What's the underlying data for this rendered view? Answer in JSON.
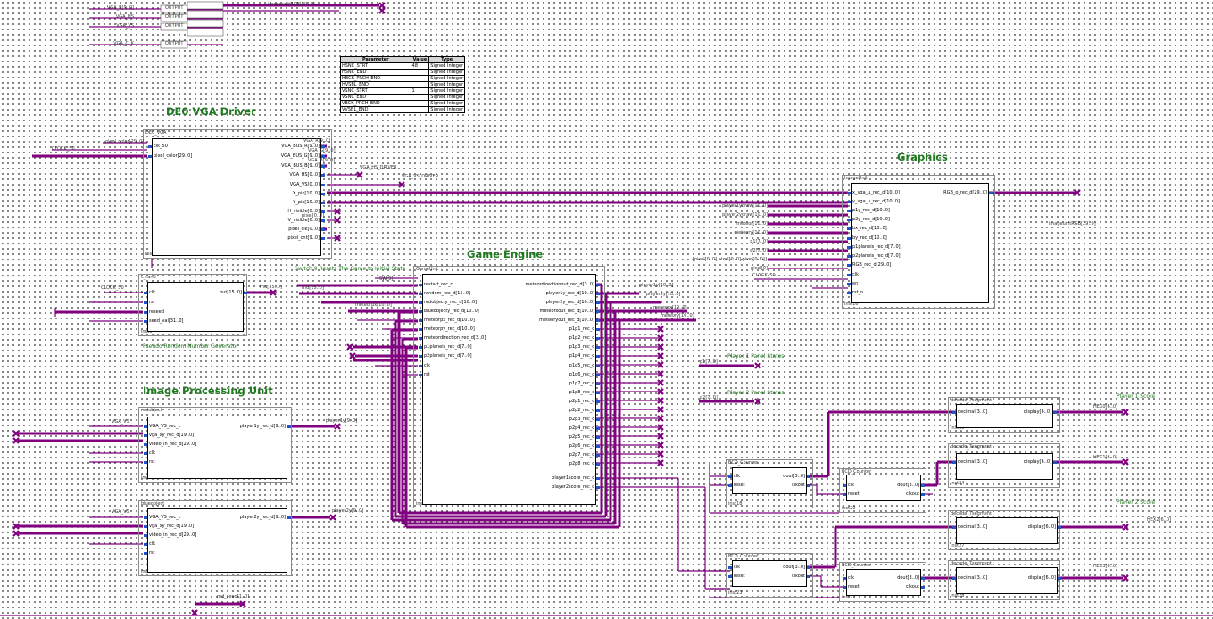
{
  "titles": {
    "vga_driver": "DE0 VGA Driver",
    "graphics": "Graphics",
    "game_engine": "Game Engine",
    "image_processing": "Image Processing Unit"
  },
  "notes": {
    "prng": "Pseudo Random Number Generator",
    "reset": "Switch 9 Resets The Game to Initial State",
    "p1_panel": "Player 1 Panel States",
    "p2_panel": "Player 2 Panel States",
    "p1_score": "Player 1 Score",
    "p2_score": "Player 2 Score"
  },
  "param_table": {
    "headers": [
      "Parameter",
      "Value",
      "Type"
    ],
    "rows": [
      [
        "HSNC_STRT",
        "48",
        "Signed Integer"
      ],
      [
        "HSNC_END",
        "",
        "Signed Integer"
      ],
      [
        "HBCK_PRCH_END",
        "",
        "Signed Integer"
      ],
      [
        "HVSBL_END",
        "",
        "Signed Integer"
      ],
      [
        "VSNC_STRT",
        "1",
        "Signed Integer"
      ],
      [
        "VSNC_END",
        "",
        "Signed Integer"
      ],
      [
        "VBCK_PRCH_END",
        "",
        "Signed Integer"
      ],
      [
        "VVSBL_END",
        "",
        "Signed Integer"
      ]
    ]
  },
  "blocks": {
    "de0_vga": {
      "type": "DE0_VGA",
      "inst": "inst11",
      "in": [
        "clk_50",
        "pixel_color[29..0]"
      ],
      "out": [
        "VGA_BUS_R[9..0]",
        "VGA_BUS_G[9..0]",
        "VGA_BUS_B[9..0]",
        "VGA_HS[0..0]",
        "VGA_VS[0..0]",
        "X_pix[10..0]",
        "Y_pix[10..0]",
        "H_visible[0..0]",
        "V_visible[0..0]",
        "pixel_clk[0..0]",
        "pixel_cnt[9..0]"
      ]
    },
    "c_rand": {
      "type": "c_rand",
      "inst": "inst6",
      "in": [
        "clk",
        "rst",
        "reseed",
        "seed_val[31..0]"
      ],
      "out": [
        "out[15..0]"
      ]
    },
    "redobject": {
      "type": "redobject",
      "inst": "inst4",
      "in": [
        "VGA_VS_rec_c",
        "vga_xy_rec_d[19..0]",
        "video_in_rec_d[29..0]",
        "clk",
        "rst"
      ],
      "out": [
        "player1y_rec_d[9..0]"
      ]
    },
    "blueobject": {
      "type": "blueobject",
      "inst": "inst1",
      "in": [
        "VGA_VS_rec_c",
        "vga_xy_rec_d[19..0]",
        "video_in_rec_d[29..0]",
        "clk",
        "rst"
      ],
      "out": [
        "player2y_rec_d[9..0]"
      ]
    },
    "gameunit": {
      "type": "GameUnit",
      "inst": "inst21",
      "in": [
        "restart_rec_c",
        "random_rec_d[15..0]",
        "redobjecty_rec_d[10..0]",
        "blueobjecty_rec_d[10..0]",
        "meteorpx_rec_d[10..0]",
        "meteorpy_rec_d[10..0]",
        "meteordirection_rec_d[3..0]",
        "p1planeis_rec_d[7..0]",
        "p2planeis_rec_d[7..0]",
        "clk",
        "rst"
      ],
      "out": [
        "meteordirectionout_rec_d[3..0]",
        "player1y_rec_d[10..0]",
        "player2y_rec_d[10..0]",
        "meteorxout_rec_d[10..0]",
        "meteoryout_rec_d[10..0]",
        "p1p1_rec_c",
        "p1p2_rec_c",
        "p1p3_rec_c",
        "p1p4_rec_c",
        "p1p5_rec_c",
        "p1p6_rec_c",
        "p1p7_rec_c",
        "p1p8_rec_c",
        "p2p1_rec_c",
        "p2p2_rec_c",
        "p2p3_rec_c",
        "p2p4_rec_c",
        "p2p5_rec_c",
        "p2p6_rec_c",
        "p2p7_rec_c",
        "p2p8_rec_c",
        "player1score_rec_c",
        "player2score_rec_c"
      ]
    },
    "imageunit": {
      "type": "ImageUnit",
      "inst": "inst16",
      "in": [
        "x_vga_u_rec_d[10..0]",
        "y_vga_u_rec_d[10..0]",
        "p1y_rec_d[10..0]",
        "p2y_rec_d[10..0]",
        "bx_rec_d[10..0]",
        "by_rec_d[10..0]",
        "p1planeis_rec_d[7..0]",
        "p2planeis_rec_d[7..0]",
        "RGB_rec_d[29..0]",
        "clk",
        "en",
        "rst_n"
      ],
      "out": [
        "RGB_o_rec_d[29..0]"
      ]
    },
    "bcd1": {
      "type": "BCD_Counter",
      "inst": "inst18",
      "in": [
        "clk",
        "reset"
      ],
      "out": [
        "dout[3..0]",
        "clkout"
      ]
    },
    "bcd2": {
      "type": "BCD_Counter",
      "inst": "inst20",
      "in": [
        "clk",
        "reset"
      ],
      "out": [
        "dout[3..0]",
        "clkout"
      ]
    },
    "bcd3": {
      "type": "BCD_Counter",
      "inst": "inst23",
      "in": [
        "clk",
        "reset"
      ],
      "out": [
        "dout[3..0]",
        "clkout"
      ]
    },
    "bcd4": {
      "type": "BCD_Counter",
      "inst": "inst22",
      "in": [
        "clk",
        "reset"
      ],
      "out": [
        "dout[3..0]",
        "clkout"
      ]
    },
    "dec1": {
      "type": "decode_7segment",
      "inst": "inst30",
      "in": [
        "decimal[3..0]"
      ],
      "out": [
        "display[6..0]"
      ]
    },
    "dec2": {
      "type": "decode_7segment",
      "inst": "inst24",
      "in": [
        "decimal[3..0]"
      ],
      "out": [
        "display[6..0]"
      ]
    },
    "dec3": {
      "type": "decode_7segment",
      "inst": "inst27",
      "in": [
        "decimal[3..0]"
      ],
      "out": [
        "display[6..0]"
      ]
    },
    "dec4": {
      "type": "decode_7segment",
      "inst": "inst28",
      "in": [
        "decimal[3..0]"
      ],
      "out": [
        "display[6..0]"
      ]
    }
  },
  "labels": {
    "vga_clk": "CLOCK_50",
    "vga_color": "pixel_color[29..0]",
    "vga_bus_r": "VGA_R[9..0]",
    "vga_bus_g": "VGA_G[9..0]",
    "vga_bus_b": "VGA_B[9..0]",
    "vga_hs": "VGA_HS_DRIVER",
    "vga_vs": "VGA_VS_DRIVER",
    "pixel_clk": "pixel[0..0]",
    "crand_clk": "CLOCK_50",
    "crand_out": "rnd[15..0]",
    "sw9": "SW[9]",
    "rnd_in": "rnd[15..0]",
    "meteorpx": "meteorpx[10..0]",
    "red_vs": "VGA_VS",
    "red_out": "player1y[9..0]",
    "blue_vs": "VGA_VS",
    "blue_out": "player2y[9..0]",
    "img_out": "imageunitRGB[29..0]",
    "clock": "CLOCK_50",
    "graphics_in": [
      "player1ydraw[10..0]",
      "player2ydraw[10..0]",
      "meteor[10..0]",
      "meteory[10..0]",
      "p1[7..0]",
      "p2[7..0]",
      "{pixel[0..0],pixel[0..0],pixel[0..0]}",
      "pixel[0]"
    ],
    "game_out": [
      "player1y[10..0]",
      "player2y[10..0]",
      "meteorx[10..0]",
      "meteory[10..0]"
    ],
    "panel_p1": "p1[7..0]",
    "panel_p2": "p2[7..0]",
    "hex0": "HEX0[6..0]",
    "hex1": "HEX1[6..0]",
    "hex2": "HEX2[6..0]",
    "hex3": "HEX3[6..0]",
    "top_pins": [
      "VGA_B[9..0]",
      "VGA_HS",
      "VGA_VS",
      "VGA_CLK"
    ],
    "top_types": [
      "OUTPUT",
      "OUTPUT",
      "OUTPUT",
      "OUTPUT"
    ],
    "top_out": "imageunitRGB[29..0]",
    "bottom_left": "rnd_seed[1..0]"
  }
}
